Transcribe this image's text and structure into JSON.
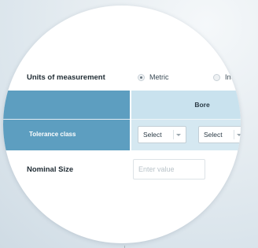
{
  "units": {
    "label": "Units of measurement",
    "options": [
      {
        "label": "Metric",
        "checked": true
      },
      {
        "label": "Inche",
        "checked": false
      }
    ]
  },
  "table": {
    "header": "Bore",
    "tolerance_label": "Tolerance class",
    "selects": [
      "Select",
      "Select"
    ]
  },
  "nominal": {
    "label": "Nominal Size",
    "placeholder": "Enter value"
  },
  "colors": {
    "header_blue": "#5d9ec0",
    "header_light": "#c9e2ee"
  }
}
